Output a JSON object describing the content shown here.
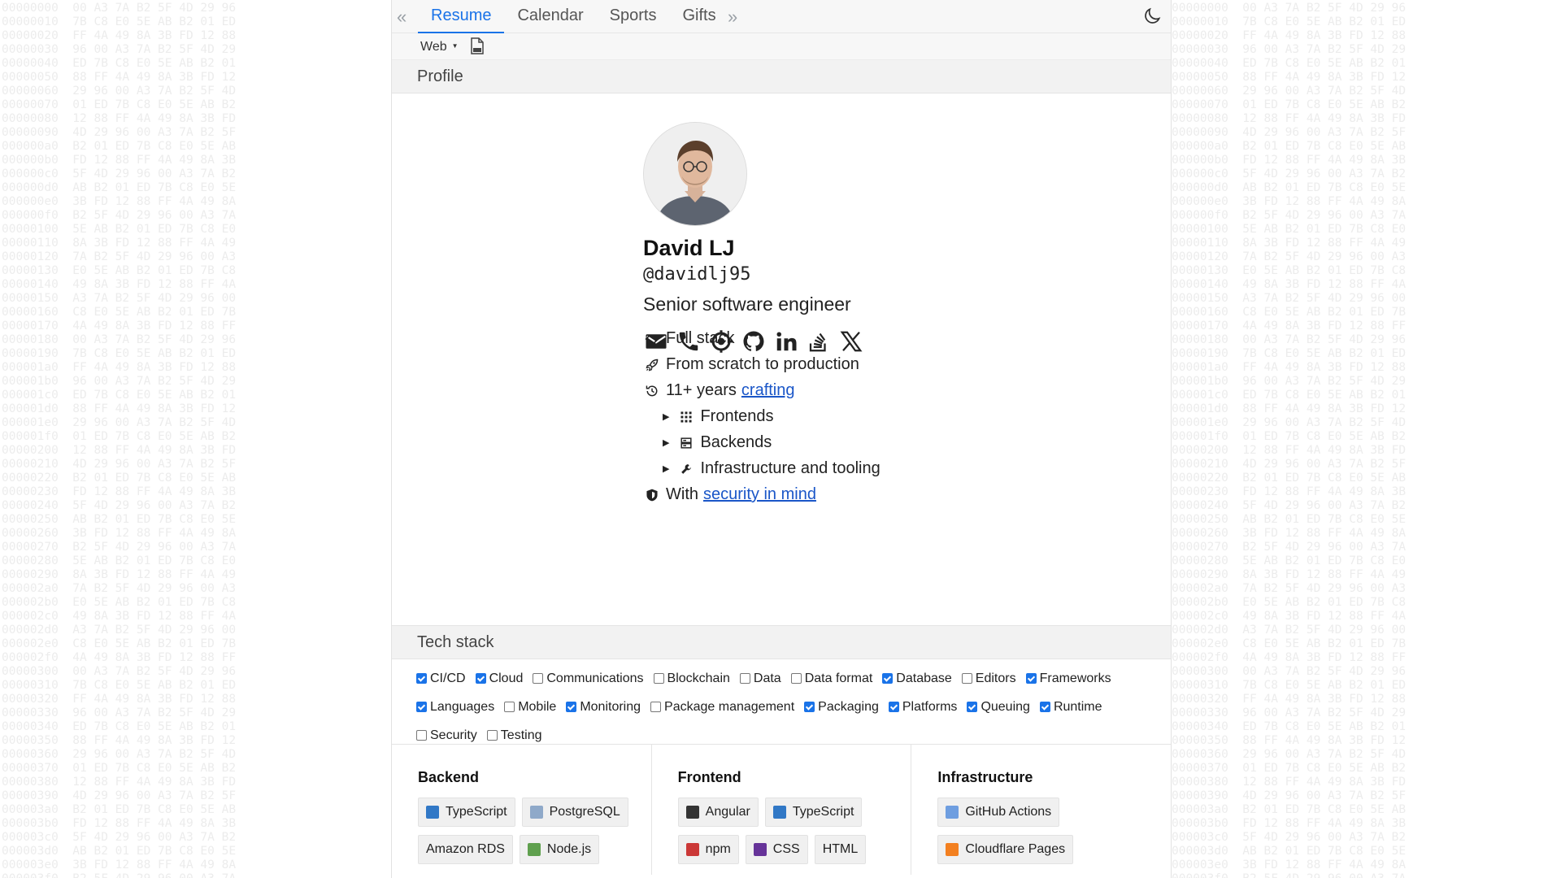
{
  "tabs": [
    {
      "label": "Resume",
      "active": true
    },
    {
      "label": "Calendar",
      "active": false
    },
    {
      "label": "Sports",
      "active": false
    },
    {
      "label": "Gifts",
      "active": false
    }
  ],
  "toolbar": {
    "format_selected": "Web",
    "pdf_icon": "pdf-icon",
    "theme_icon": "moon-icon"
  },
  "profile": {
    "section_title": "Profile",
    "name": "David LJ",
    "handle": "@davidlj95",
    "role": "Senior software engineer",
    "socials": [
      "email-icon",
      "phone-icon",
      "location-icon",
      "github-icon",
      "linkedin-icon",
      "stackoverflow-icon",
      "x-icon"
    ],
    "highlights": {
      "fullstack": "Full stack",
      "scratch": "From scratch to production",
      "years_prefix": "11+ years",
      "years_link": "crafting",
      "frontends": "Frontends",
      "backends": "Backends",
      "infra": "Infrastructure and tooling",
      "security_prefix": "With",
      "security_link": "security in mind"
    }
  },
  "techstack": {
    "section_title": "Tech stack",
    "filters_row1": [
      {
        "label": "CI/CD",
        "checked": true
      },
      {
        "label": "Cloud",
        "checked": true
      },
      {
        "label": "Communications",
        "checked": false
      },
      {
        "label": "Blockchain",
        "checked": false
      },
      {
        "label": "Data",
        "checked": false
      },
      {
        "label": "Data format",
        "checked": false
      },
      {
        "label": "Database",
        "checked": true
      },
      {
        "label": "Editors",
        "checked": false
      },
      {
        "label": "Frameworks",
        "checked": true
      }
    ],
    "filters_row2": [
      {
        "label": "Languages",
        "checked": true
      },
      {
        "label": "Mobile",
        "checked": false
      },
      {
        "label": "Monitoring",
        "checked": true
      },
      {
        "label": "Package management",
        "checked": false
      },
      {
        "label": "Packaging",
        "checked": true
      },
      {
        "label": "Platforms",
        "checked": true
      },
      {
        "label": "Queuing",
        "checked": true
      },
      {
        "label": "Runtime",
        "checked": true
      }
    ],
    "filters_row3": [
      {
        "label": "Security",
        "checked": false
      },
      {
        "label": "Testing",
        "checked": false
      }
    ],
    "columns": [
      {
        "title": "Backend",
        "items": [
          {
            "label": "TypeScript",
            "color": "#3178c6",
            "icon": "typescript-icon"
          },
          {
            "label": "PostgreSQL",
            "color": "#8fa9c9",
            "icon": "postgresql-icon"
          },
          {
            "label": "Amazon RDS",
            "color": "",
            "icon": ""
          },
          {
            "label": "Node.js",
            "color": "#5fa04e",
            "icon": "nodejs-icon"
          }
        ]
      },
      {
        "title": "Frontend",
        "items": [
          {
            "label": "Angular",
            "color": "#333333",
            "icon": "angular-icon"
          },
          {
            "label": "TypeScript",
            "color": "#3178c6",
            "icon": "typescript-icon"
          },
          {
            "label": "npm",
            "color": "#cb3837",
            "icon": "npm-icon"
          },
          {
            "label": "CSS",
            "color": "#663399",
            "icon": "css-icon"
          },
          {
            "label": "HTML",
            "color": "",
            "icon": ""
          }
        ]
      },
      {
        "title": "Infrastructure",
        "items": [
          {
            "label": "GitHub Actions",
            "color": "#6e9ee0",
            "icon": "github-actions-icon"
          },
          {
            "label": "Cloudflare Pages",
            "color": "#f38020",
            "icon": "cloudflare-pages-icon"
          }
        ]
      }
    ]
  }
}
